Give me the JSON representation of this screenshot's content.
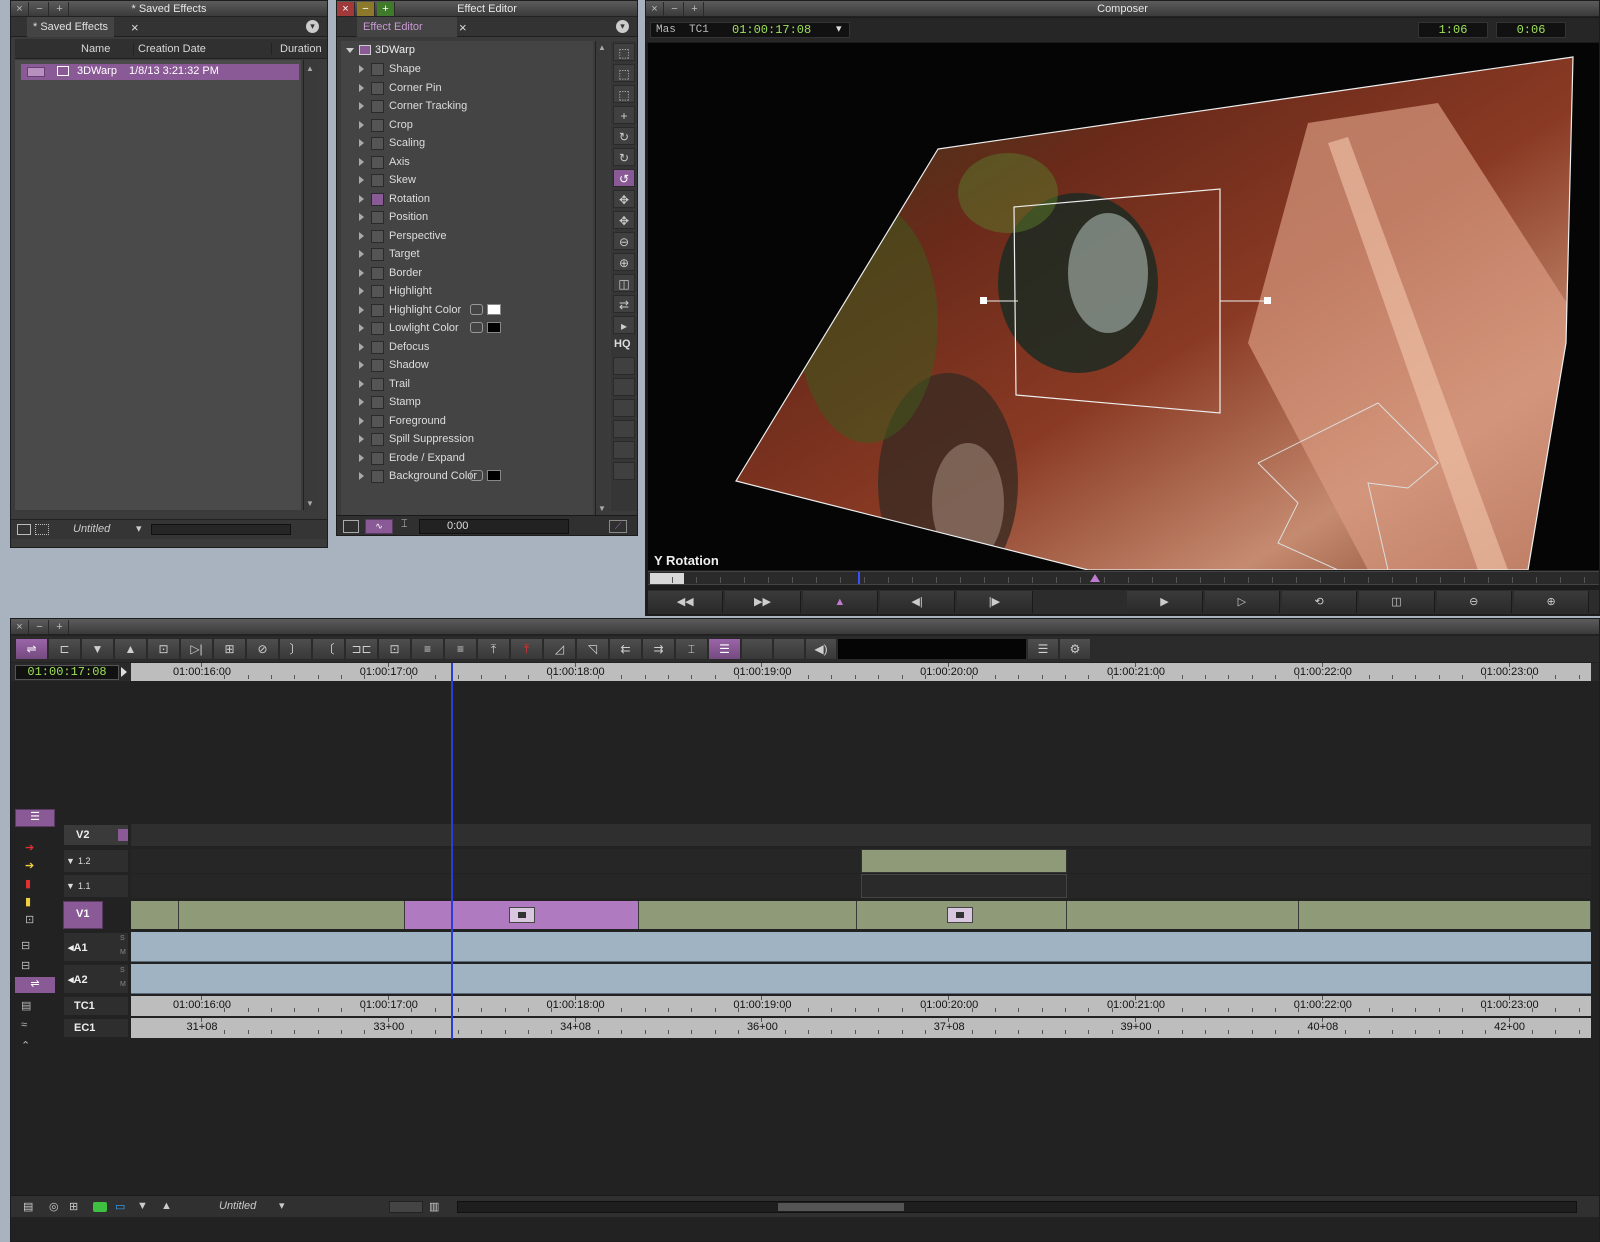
{
  "saved_effects": {
    "window_title": "* Saved Effects",
    "tab_label": "* Saved Effects",
    "columns": [
      "Name",
      "Creation Date",
      "Duration"
    ],
    "rows": [
      {
        "name": "3DWarp",
        "date": "1/8/13 3:21:32 PM"
      }
    ],
    "bin_view": "Untitled"
  },
  "effect_editor": {
    "window_title": "Effect Editor",
    "tab_label": "Effect Editor",
    "root": "3DWarp",
    "params": [
      "Shape",
      "Corner Pin",
      "Corner Tracking",
      "Crop",
      "Scaling",
      "Axis",
      "Skew",
      "Rotation",
      "Position",
      "Perspective",
      "Target",
      "Border",
      "Highlight",
      "Highlight Color",
      "Lowlight Color",
      "Defocus",
      "Shadow",
      "Trail",
      "Stamp",
      "Foreground",
      "Spill Suppression",
      "Erode / Expand",
      "Background Color"
    ],
    "selected_param": "Rotation",
    "duration": "0:00",
    "hq_label": "HQ"
  },
  "composer": {
    "window_title": "Composer",
    "tc_label": "Mas  TC1",
    "timecode": "01:00:17:08",
    "counter1": "1:06",
    "counter2": "0:06",
    "overlay": "Y Rotation"
  },
  "timeline": {
    "position": "01:00:17:08",
    "ruler": [
      "01:00:16:00",
      "01:00:17:00",
      "01:00:18:00",
      "01:00:19:00",
      "01:00:20:00",
      "01:00:21:00",
      "01:00:22:00",
      "01:00:23:00"
    ],
    "ec_ruler": [
      "31+08",
      "33+00",
      "34+08",
      "36+00",
      "37+08",
      "39+00",
      "40+08",
      "42+00"
    ],
    "tracks": {
      "v2": "V2",
      "l12": "1.2",
      "l11": "1.1",
      "v1": "V1",
      "a1": "A1",
      "a2": "A2",
      "tc1": "TC1",
      "ec1": "EC1"
    },
    "sequence_name": "Untitled"
  },
  "colors": {
    "accent": "#8a5a96",
    "clip_video": "#8e9a78",
    "clip_audio": "#9fb3c2",
    "timecode": "#9fe05a",
    "playhead": "#2b3dd6"
  }
}
